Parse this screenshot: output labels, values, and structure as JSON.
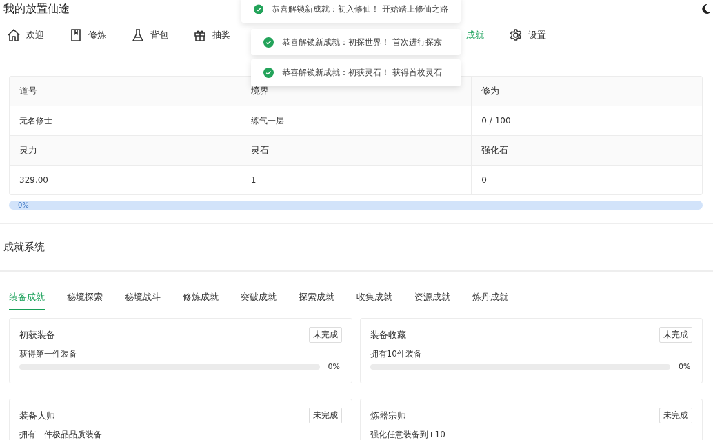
{
  "app_title": "我的放置仙途",
  "nav": [
    {
      "label": "欢迎",
      "selected": false
    },
    {
      "label": "修炼",
      "selected": false
    },
    {
      "label": "背包",
      "selected": false
    },
    {
      "label": "抽奖",
      "selected": false
    },
    {
      "label": "成就",
      "selected": true
    },
    {
      "label": "设置",
      "selected": false
    }
  ],
  "toasts": [
    "恭喜解锁新成就：初入修仙！ 开始踏上修仙之路",
    "恭喜解锁新成就：初探世界！ 首次进行探索",
    "恭喜解锁新成就：初获灵石！ 获得首枚灵石"
  ],
  "stats": {
    "rows": [
      {
        "kind": "header",
        "cells": [
          "道号",
          "境界",
          "修为"
        ]
      },
      {
        "kind": "value",
        "cells": [
          "无名修士",
          "练气一层",
          "0 / 100"
        ]
      },
      {
        "kind": "header",
        "cells": [
          "灵力",
          "灵石",
          "强化石"
        ]
      },
      {
        "kind": "value",
        "cells": [
          "329.00",
          "1",
          "0"
        ]
      }
    ],
    "progress": {
      "level": 0,
      "label": "0%"
    }
  },
  "achievements": {
    "title": "成就系统",
    "tabs": [
      {
        "label": "装备成就",
        "selected": true
      },
      {
        "label": "秘境探索",
        "selected": false
      },
      {
        "label": "秘境战斗",
        "selected": false
      },
      {
        "label": "修炼成就",
        "selected": false
      },
      {
        "label": "突破成就",
        "selected": false
      },
      {
        "label": "探索成就",
        "selected": false
      },
      {
        "label": "收集成就",
        "selected": false
      },
      {
        "label": "资源成就",
        "selected": false
      },
      {
        "label": "炼丹成就",
        "selected": false
      }
    ],
    "cards": [
      {
        "title": "初获装备",
        "status": "未完成",
        "description": "获得第一件装备",
        "level": 0,
        "percent": "0%"
      },
      {
        "title": "装备收藏",
        "status": "未完成",
        "description": "拥有10件装备",
        "level": 0,
        "percent": "0%"
      },
      {
        "title": "装备大师",
        "status": "未完成",
        "description": "拥有一件极品品质装备"
      },
      {
        "title": "炼器宗师",
        "status": "未完成",
        "description": "强化任意装备到+10"
      }
    ]
  }
}
